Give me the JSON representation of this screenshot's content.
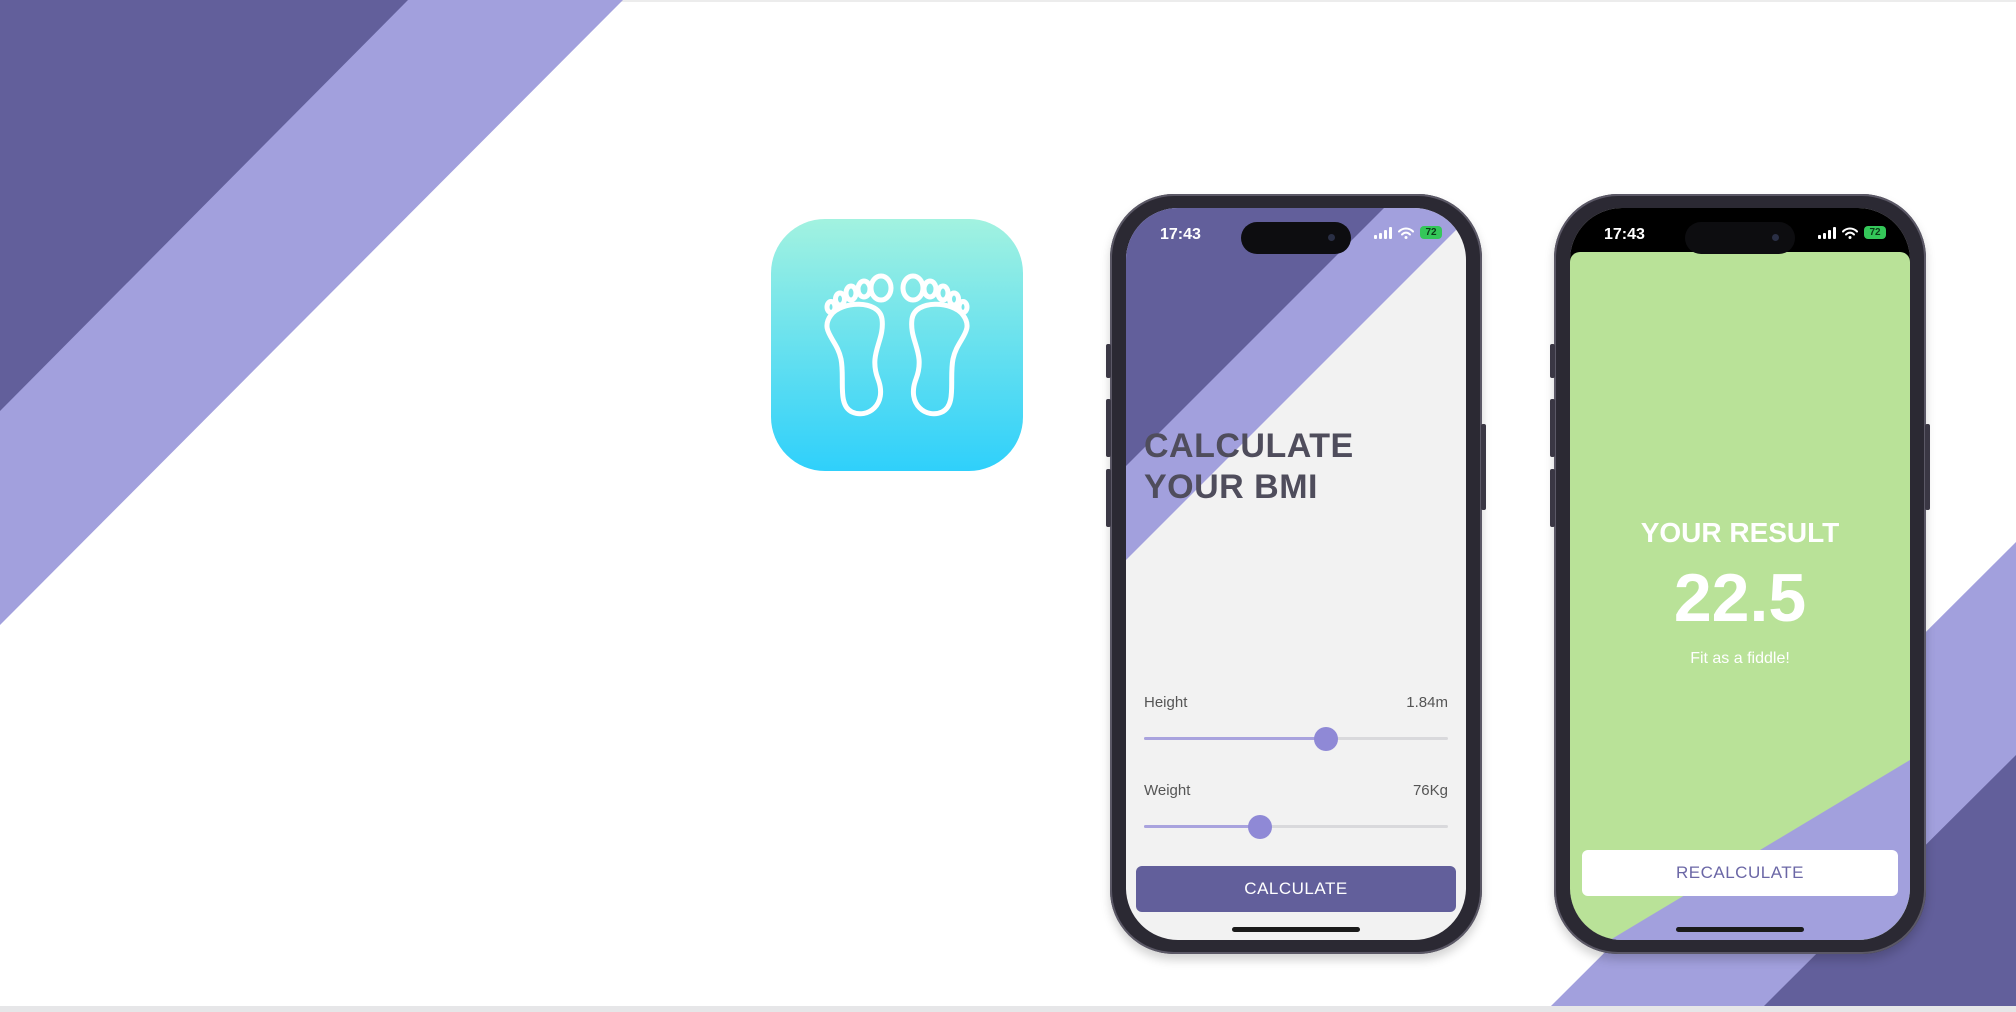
{
  "colors": {
    "dark_purple": "#625f9b",
    "light_purple": "#a2a0dd",
    "screen_bg": "#f2f2f2",
    "result_green": "#b9e298",
    "slider_thumb": "#8f89d6",
    "battery_green": "#34c759"
  },
  "app_icon": {
    "icon": "footprints-icon"
  },
  "calculator_screen": {
    "status_time": "17:43",
    "battery_level": "72",
    "title_line1": "CALCULATE",
    "title_line2": "YOUR BMI",
    "height": {
      "label": "Height",
      "value": "1.84m",
      "fraction": 0.6
    },
    "weight": {
      "label": "Weight",
      "value": "76Kg",
      "fraction": 0.38
    },
    "calculate_button": "CALCULATE"
  },
  "result_screen": {
    "status_time": "17:43",
    "battery_level": "72",
    "heading": "YOUR RESULT",
    "bmi_value": "22.5",
    "message": "Fit as a fiddle!",
    "recalculate_button": "RECALCULATE"
  }
}
